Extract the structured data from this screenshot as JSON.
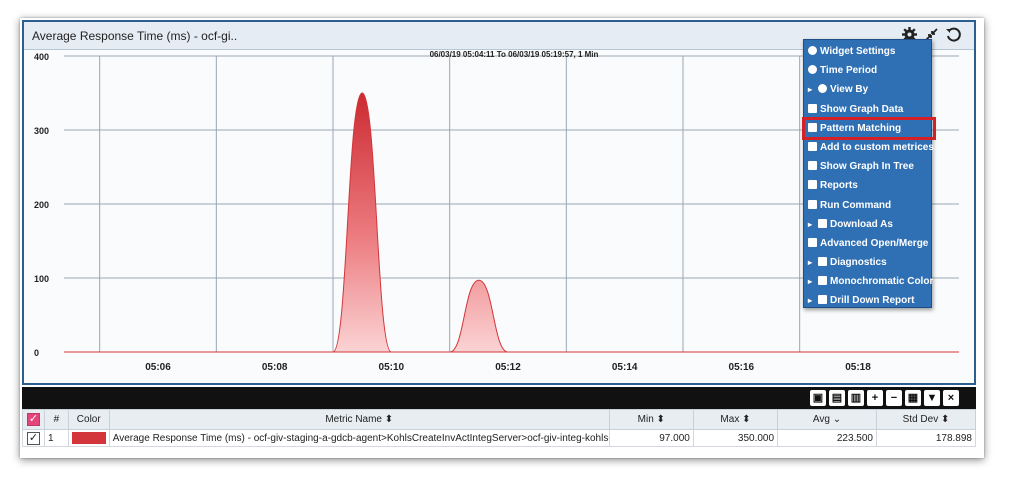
{
  "widget": {
    "title": "Average Response Time (ms) - ocf-gi..",
    "icons": [
      "gear-icon",
      "collapse-icon",
      "refresh-icon"
    ]
  },
  "chart_data": {
    "type": "area",
    "subtitle": "06/03/19 05:04:11 To 06/03/19 05:19:57, 1 Min",
    "y_ticks": [
      "400",
      "300",
      "200",
      "100",
      "0"
    ],
    "ylim": [
      0,
      400
    ],
    "x_ticks": [
      "05:06",
      "05:08",
      "05:10",
      "05:12",
      "05:14",
      "05:16",
      "05:18"
    ],
    "series": [
      {
        "color": "#d2363a",
        "x": [
          "05:09",
          "05:09:30",
          "05:10",
          "05:10:30",
          "05:11",
          "05:11:30",
          "05:12",
          "05:12:30"
        ],
        "values": [
          0,
          350,
          0,
          0,
          0,
          97,
          0,
          0
        ]
      }
    ],
    "grid": true
  },
  "context_menu": {
    "items": [
      {
        "label": "Widget Settings",
        "icon": "refresh-icon",
        "submenu": false
      },
      {
        "label": "Time Period",
        "icon": "clock-icon",
        "submenu": false
      },
      {
        "label": "View By",
        "icon": "eye-icon",
        "submenu": true
      },
      {
        "label": "Show Graph Data",
        "icon": "window-icon",
        "submenu": false
      },
      {
        "label": "Pattern Matching",
        "icon": "window-icon",
        "submenu": false,
        "highlighted": true
      },
      {
        "label": "Add to custom metrices",
        "icon": "window-icon",
        "submenu": false
      },
      {
        "label": "Show Graph In Tree",
        "icon": "window-icon",
        "submenu": false
      },
      {
        "label": "Reports",
        "icon": "window-icon",
        "submenu": false
      },
      {
        "label": "Run Command",
        "icon": "window-icon",
        "submenu": false
      },
      {
        "label": "Download As",
        "icon": "window-icon",
        "submenu": true
      },
      {
        "label": "Advanced Open/Merge",
        "icon": "window-icon",
        "submenu": false
      },
      {
        "label": "Diagnostics",
        "icon": "window-icon",
        "submenu": true
      },
      {
        "label": "Monochromatic Color",
        "icon": "brush-icon",
        "submenu": true
      },
      {
        "label": "Drill Down Report",
        "icon": "window-icon",
        "submenu": true
      }
    ]
  },
  "table_toolbar": {
    "buttons": [
      "pdf-icon",
      "excel-icon",
      "export-icon",
      "plus-icon",
      "minus-icon",
      "grid-icon",
      "filter-icon",
      "close-icon"
    ]
  },
  "table": {
    "headers": {
      "index": "#",
      "color": "Color",
      "metric": "Metric Name ⬍",
      "min": "Min ⬍",
      "max": "Max ⬍",
      "avg": "Avg ⌄",
      "std": "Std Dev ⬍"
    },
    "rows": [
      {
        "index": "1",
        "color": "#d2363a",
        "metric": "Average Response Time (ms) - ocf-giv-staging-a-gdcb-agent>KohlsCreateInvActIntegServer>ocf-giv-integ-kohls-",
        "min": "97.000",
        "max": "350.000",
        "avg": "223.500",
        "std": "178.898"
      }
    ]
  }
}
